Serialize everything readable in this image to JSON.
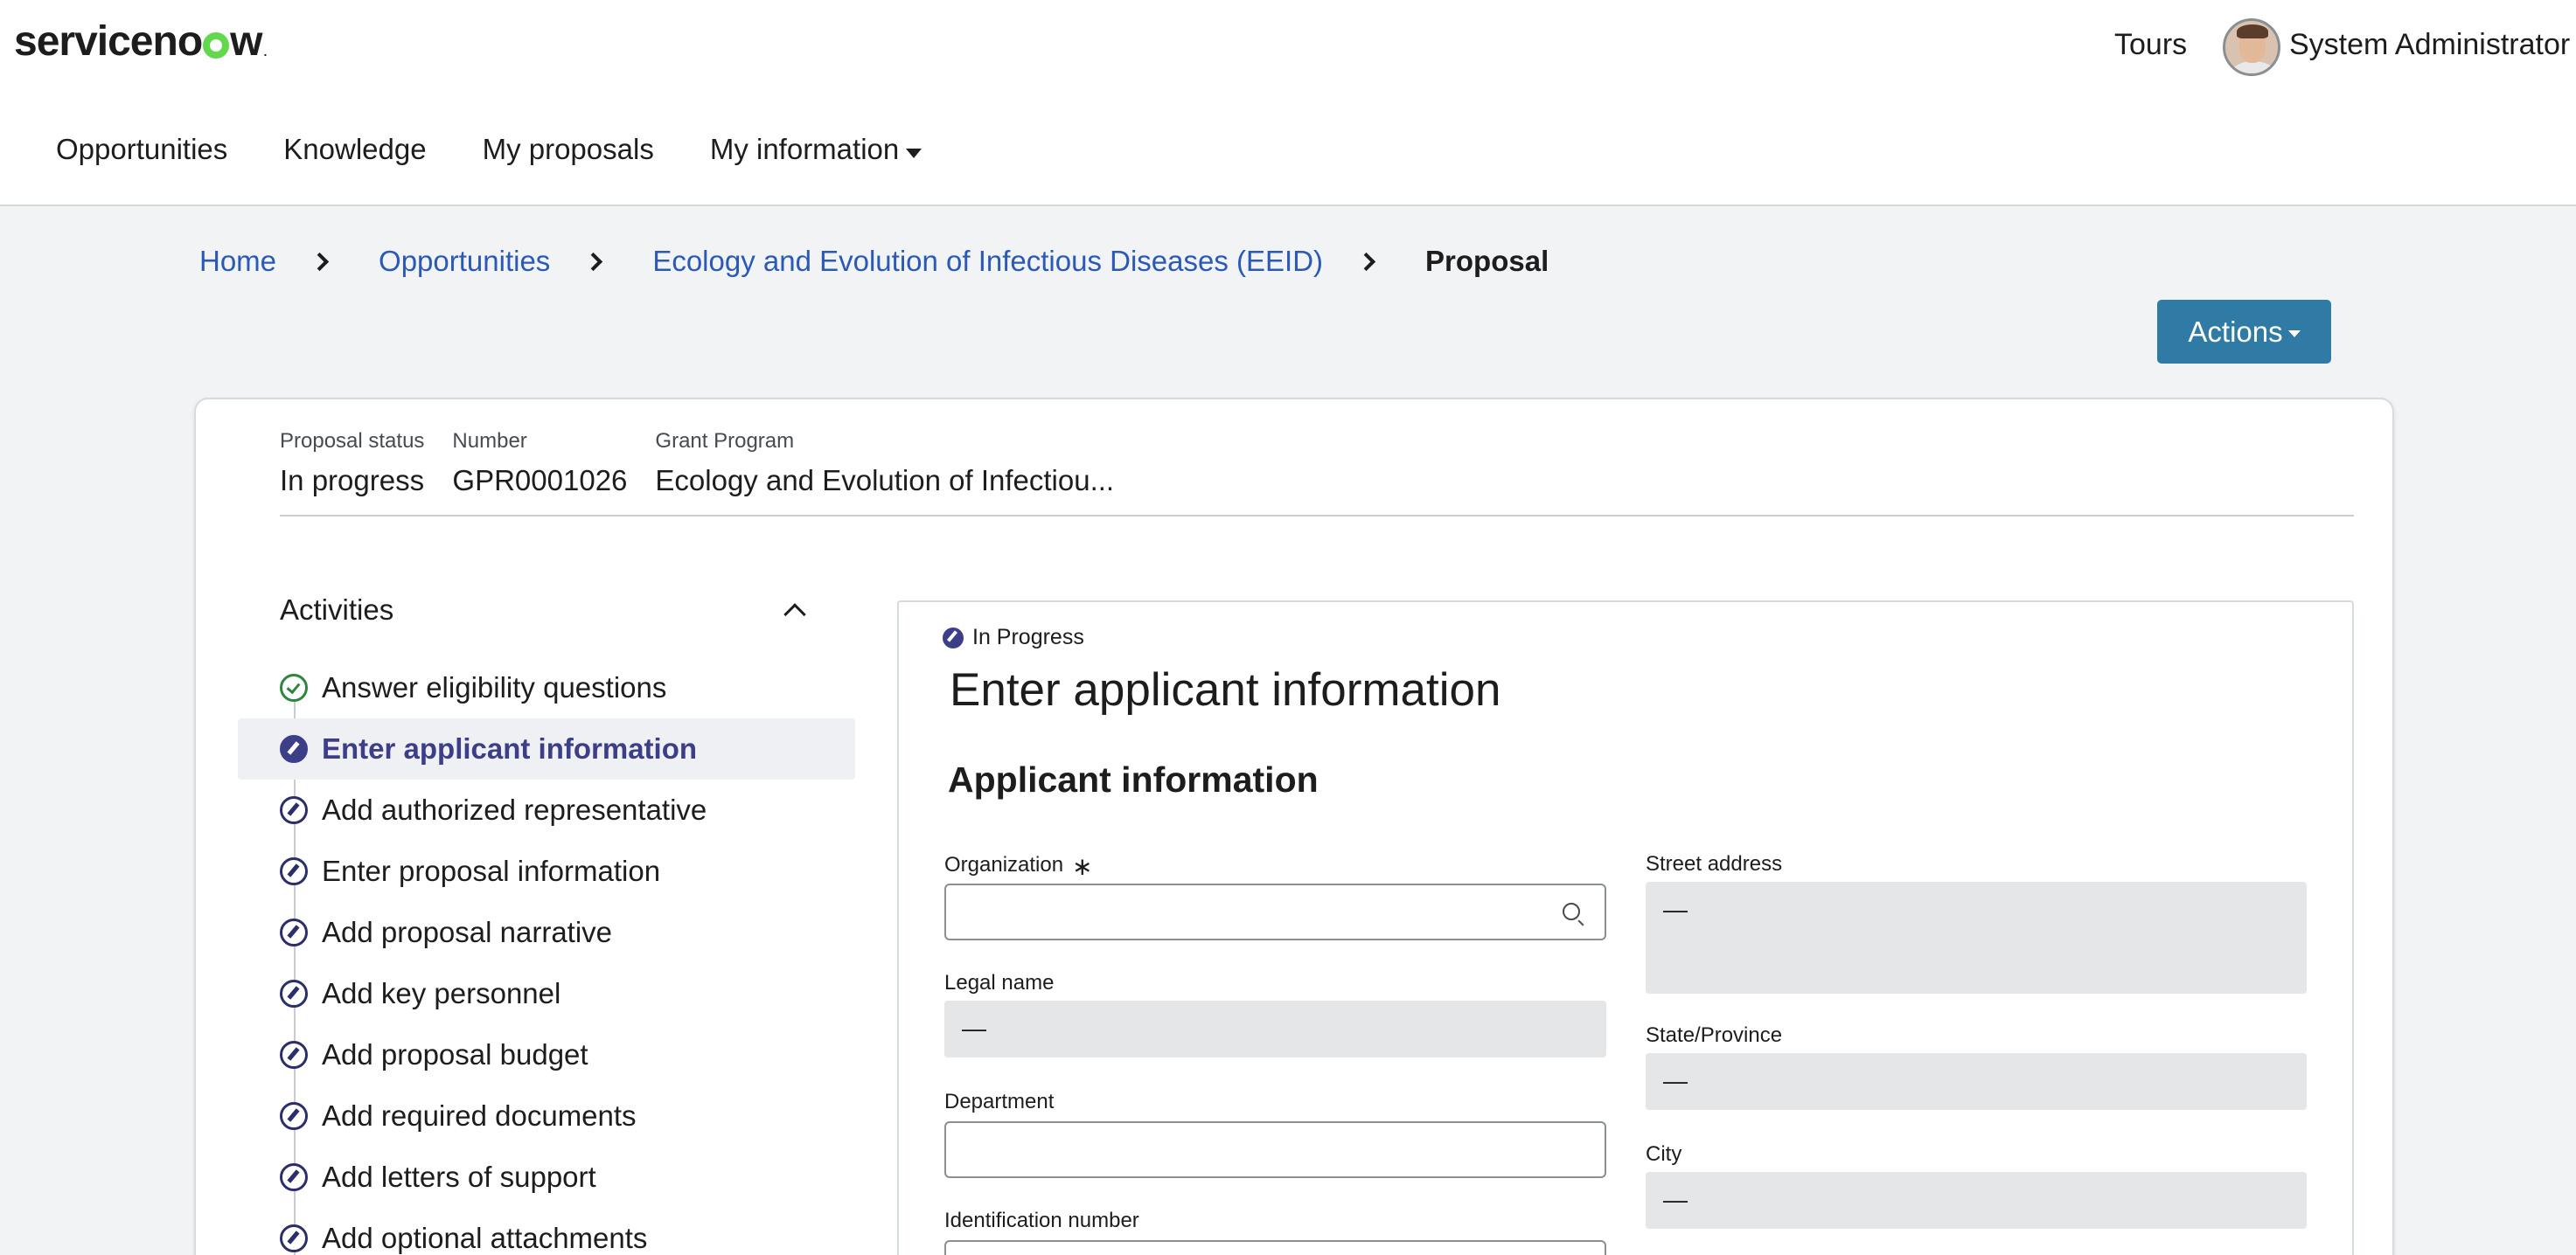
{
  "header": {
    "logo_text": "servicenow",
    "tours_label": "Tours",
    "user_name": "System Administrator"
  },
  "nav": {
    "items": [
      {
        "label": "Opportunities"
      },
      {
        "label": "Knowledge"
      },
      {
        "label": "My proposals"
      },
      {
        "label": "My information"
      }
    ]
  },
  "breadcrumb": {
    "home": "Home",
    "opportunities": "Opportunities",
    "program": "Ecology and Evolution of Infectious Diseases (EEID)",
    "current": "Proposal"
  },
  "actions_label": "Actions",
  "summary": {
    "status_label": "Proposal status",
    "status_value": "In progress",
    "number_label": "Number",
    "number_value": "GPR0001026",
    "program_label": "Grant Program",
    "program_value": "Ecology and Evolution of Infectiou..."
  },
  "activities": {
    "title": "Activities",
    "items": [
      {
        "label": "Answer eligibility questions",
        "state": "done"
      },
      {
        "label": "Enter applicant information",
        "state": "current"
      },
      {
        "label": "Add authorized representative",
        "state": "pending"
      },
      {
        "label": "Enter proposal information",
        "state": "pending"
      },
      {
        "label": "Add proposal narrative",
        "state": "pending"
      },
      {
        "label": "Add key personnel",
        "state": "pending"
      },
      {
        "label": "Add proposal budget",
        "state": "pending"
      },
      {
        "label": "Add required documents",
        "state": "pending"
      },
      {
        "label": "Add letters of support",
        "state": "pending"
      },
      {
        "label": "Add optional attachments",
        "state": "pending"
      }
    ]
  },
  "form": {
    "status": "In Progress",
    "title": "Enter applicant information",
    "section": "Applicant information",
    "fields": {
      "organization_label": "Organization",
      "organization_required": "∗",
      "organization_value": "",
      "legal_name_label": "Legal name",
      "legal_name_value": "—",
      "department_label": "Department",
      "department_value": "",
      "identification_label": "Identification number",
      "street_label": "Street address",
      "street_value": "—",
      "state_label": "State/Province",
      "state_value": "—",
      "city_label": "City",
      "city_value": "—"
    }
  },
  "colors": {
    "accent": "#2f7ba6",
    "link": "#2a59b7",
    "activity_active": "#3c3f87",
    "done_green": "#2e8540",
    "logo_green": "#62d84e"
  }
}
